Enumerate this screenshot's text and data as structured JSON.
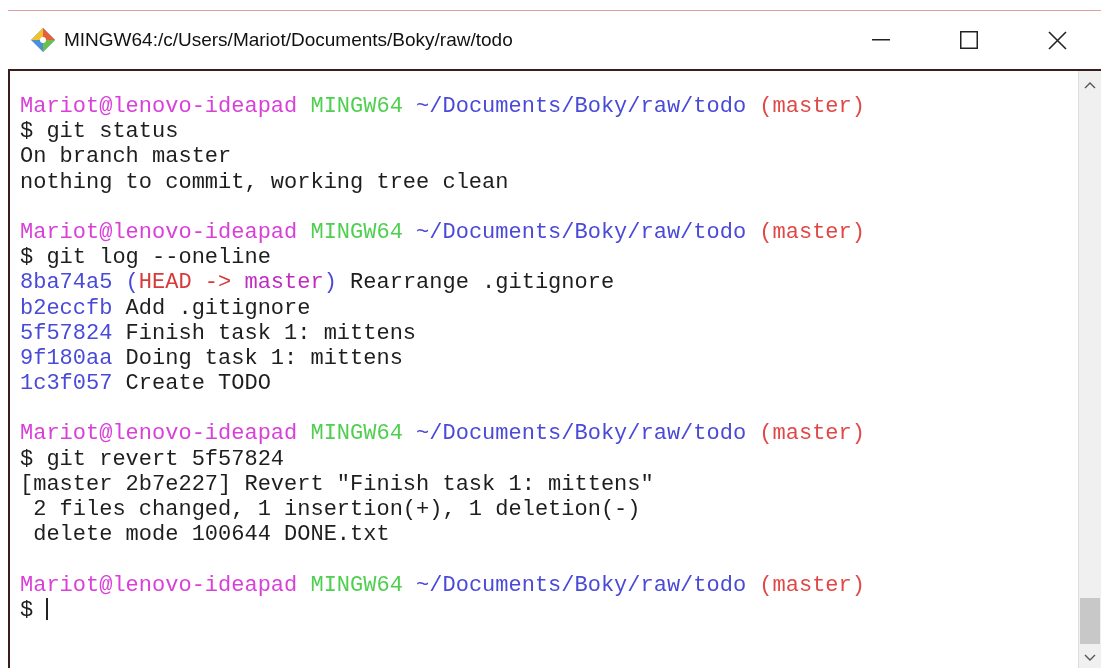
{
  "window": {
    "title": "MINGW64:/c/Users/Mariot/Documents/Boky/raw/todo"
  },
  "blocks": [
    {
      "prompt": {
        "user": "Mariot@lenovo-ideapad",
        "host": "MINGW64",
        "path": "~/Documents/Boky/raw/todo",
        "branch": "(master)"
      },
      "command": "$ git status",
      "output": [
        [
          {
            "kind": "text",
            "text": "On branch master"
          }
        ],
        [
          {
            "kind": "text",
            "text": "nothing to commit, working tree clean"
          }
        ]
      ]
    },
    {
      "prompt": {
        "user": "Mariot@lenovo-ideapad",
        "host": "MINGW64",
        "path": "~/Documents/Boky/raw/todo",
        "branch": "(master)"
      },
      "command": "$ git log --oneline",
      "output": [
        [
          {
            "kind": "hash",
            "text": "8ba74a5"
          },
          {
            "kind": "paren",
            "text": " ("
          },
          {
            "kind": "head",
            "text": "HEAD -> "
          },
          {
            "kind": "ref",
            "text": "master"
          },
          {
            "kind": "paren",
            "text": ")"
          },
          {
            "kind": "text",
            "text": " Rearrange .gitignore"
          }
        ],
        [
          {
            "kind": "hash",
            "text": "b2eccfb"
          },
          {
            "kind": "text",
            "text": " Add .gitignore"
          }
        ],
        [
          {
            "kind": "hash",
            "text": "5f57824"
          },
          {
            "kind": "text",
            "text": " Finish task 1: mittens"
          }
        ],
        [
          {
            "kind": "hash",
            "text": "9f180aa"
          },
          {
            "kind": "text",
            "text": " Doing task 1: mittens"
          }
        ],
        [
          {
            "kind": "hash",
            "text": "1c3f057"
          },
          {
            "kind": "text",
            "text": " Create TODO"
          }
        ]
      ]
    },
    {
      "prompt": {
        "user": "Mariot@lenovo-ideapad",
        "host": "MINGW64",
        "path": "~/Documents/Boky/raw/todo",
        "branch": "(master)"
      },
      "command": "$ git revert 5f57824",
      "output": [
        [
          {
            "kind": "text",
            "text": "[master 2b7e227] Revert \"Finish task 1: mittens\""
          }
        ],
        [
          {
            "kind": "text",
            "text": " 2 files changed, 1 insertion(+), 1 deletion(-)"
          }
        ],
        [
          {
            "kind": "text",
            "text": " delete mode 100644 DONE.txt"
          }
        ]
      ]
    },
    {
      "prompt": {
        "user": "Mariot@lenovo-ideapad",
        "host": "MINGW64",
        "path": "~/Documents/Boky/raw/todo",
        "branch": "(master)"
      },
      "command": "$",
      "cursor": true
    }
  ]
}
